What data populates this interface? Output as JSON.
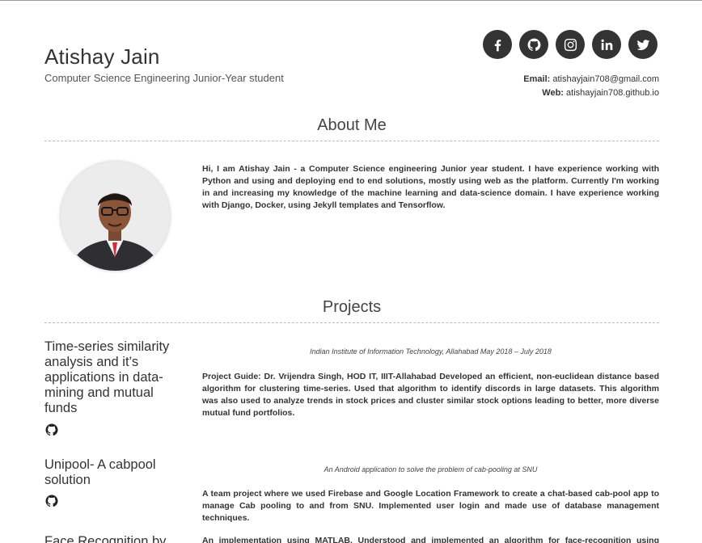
{
  "header": {
    "name": "Atishay Jain",
    "subtitle": "Computer Science Engineering Junior-Year student",
    "email_label": "Email:",
    "email": "atishayjain708@gmail.com",
    "web_label": "Web:",
    "web": "atishayjain708.github.io",
    "socials": [
      "facebook-icon",
      "github-icon",
      "instagram-icon",
      "linkedin-icon",
      "twitter-icon"
    ]
  },
  "about": {
    "title": "About Me",
    "text": "Hi, I am Atishay Jain - a Computer Science engineering Junior year student. I have experience working with Python and using and deploying end to end solutions, mostly using web as the platform. Currently I'm working in and increasing my knowledge of the machine learning and data-science domain. I have experience working with Django, Docker, using Jekyll templates and Tensorflow."
  },
  "projects": {
    "title": "Projects",
    "items": [
      {
        "title": "Time-series similarity analysis and it’s applications in data-mining and mutual funds",
        "meta": "Indian Institute of Information Technology, Allahabad May 2018 – July 2018",
        "description": "Project Guide: Dr. Vrijendra Singh, HOD IT, IIIT-Allahabad Developed an efficient, non-euclidean distance based algorithm for clustering time-series. Used that algorithm to identify discords in large datasets. This algorithm was also used to analyze trends in stock prices and cluster similar stock options leading to better, more diverse mutual fund portfolios."
      },
      {
        "title": "Unipool- A cabpool solution",
        "meta": "An Android application to solve the problem of cab-pooling at SNU",
        "description": "A team project where we used Firebase and Google Location Framework to create a chat-based cab-pool app to manage Cab pooling to and from SNU. Implemented user login and made use of database management techniques."
      },
      {
        "title": "Face Recognition by",
        "meta": "",
        "description": "An implementation using MATLAB. Understood and implemented an algorithm for face-recognition using eigenfaces"
      }
    ]
  },
  "colors": {
    "text": "#333333",
    "social_bg": "#333333",
    "divider": "#bbbbbb"
  }
}
